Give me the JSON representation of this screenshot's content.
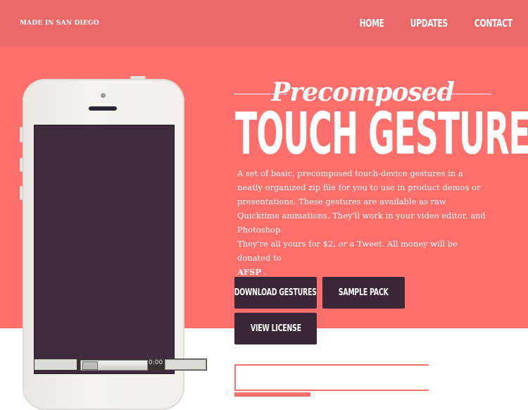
{
  "header": {
    "brand": "MADE IN SAN DIEGO",
    "nav": [
      "HOME",
      "UPDATES",
      "CONTACT"
    ]
  },
  "hero": {
    "pre_title": "Precomposed",
    "title": "TOUCH GESTURES",
    "description": "A set of basic, precomposed touch-device gestures in a neatly organized zip file for you to use in product demos or presentations. These gestures are available as raw Quicktime animations. They'll work in your video editor, and Photoshop.",
    "price_part1": "They're all yours for $2, ",
    "price_or": "or",
    "price_part2": " a Tweet. All money will be donated to ",
    "price_org": "AFSP",
    "price_end": " ."
  },
  "buttons": {
    "download": "DOWNLOAD GESTURES",
    "sample": "SAMPLE PACK",
    "license": "VIEW LICENSE"
  },
  "video": {
    "time": "0:00"
  },
  "colors": {
    "hero_bg": "#fe6e6a",
    "header_bg": "#ec6969",
    "button_bg": "#3b2638",
    "screen": "#3e2c3d"
  }
}
